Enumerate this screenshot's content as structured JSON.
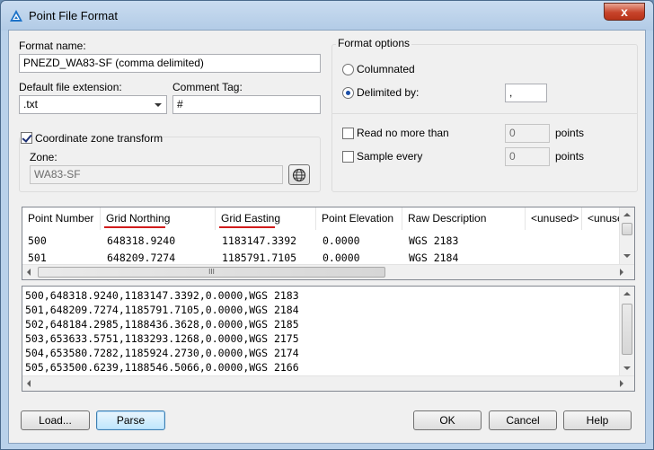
{
  "window": {
    "title": "Point File Format",
    "close_glyph": "x"
  },
  "format": {
    "name_label": "Format name:",
    "name_value": "PNEZD_WA83-SF (comma delimited)",
    "ext_label": "Default file extension:",
    "ext_value": ".txt",
    "comment_label": "Comment Tag:",
    "comment_value": "#",
    "coord_label": "Coordinate zone transform",
    "coord_checked": true,
    "zone_label": "Zone:",
    "zone_value": "WA83-SF"
  },
  "options": {
    "legend": "Format options",
    "columnated_label": "Columnated",
    "delimited_label": "Delimited by:",
    "delimiter_value": ",",
    "read_label": "Read no more than",
    "read_value": "0",
    "read_unit": "points",
    "sample_label": "Sample every",
    "sample_value": "0",
    "sample_unit": "points"
  },
  "table": {
    "columns": [
      "Point Number",
      "Grid Northing",
      "Grid Easting",
      "Point Elevation",
      "Raw Description",
      "<unused>",
      "<unuse"
    ],
    "rows": [
      [
        "500",
        "648318.9240",
        "1183147.3392",
        "0.0000",
        "WGS 2183"
      ],
      [
        "501",
        "648209.7274",
        "1185791.7105",
        "0.0000",
        "WGS 2184"
      ]
    ]
  },
  "raw_lines": [
    "500,648318.9240,1183147.3392,0.0000,WGS 2183",
    "501,648209.7274,1185791.7105,0.0000,WGS 2184",
    "502,648184.2985,1188436.3628,0.0000,WGS 2185",
    "503,653633.5751,1183293.1268,0.0000,WGS 2175",
    "504,653580.7282,1185924.2730,0.0000,WGS 2174",
    "505,653500.6239,1188546.5066,0.0000,WGS 2166"
  ],
  "buttons": {
    "load": "Load...",
    "parse": "Parse",
    "ok": "OK",
    "cancel": "Cancel",
    "help": "Help"
  },
  "icons": {
    "app": "civil-3d-icon",
    "globe": "globe-icon",
    "scroll_grip": "III"
  },
  "colors": {
    "underline": "#d11b1b",
    "default_button": "#bee6fd"
  }
}
